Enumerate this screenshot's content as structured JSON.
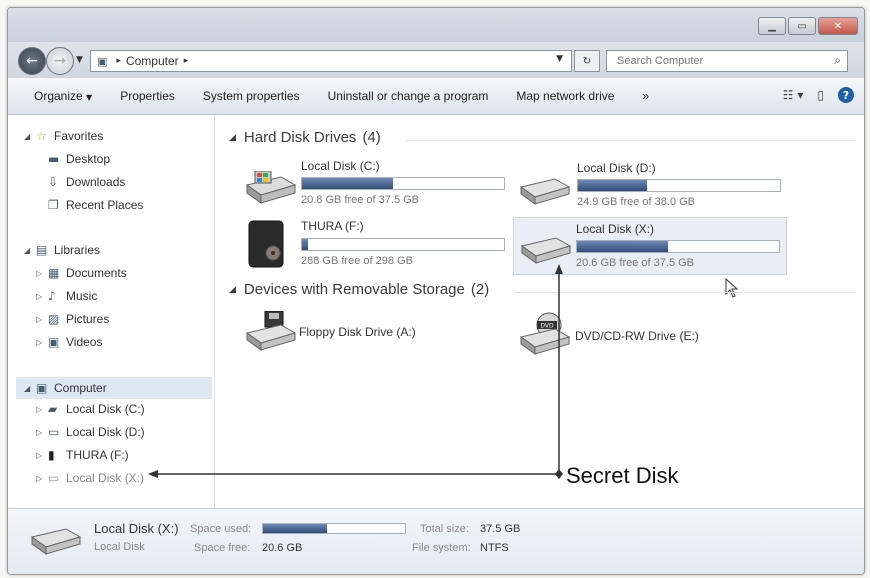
{
  "window": {
    "minimize_icon": "minimize-icon",
    "maximize_icon": "maximize-icon",
    "close_icon": "close-icon"
  },
  "address_bar": {
    "crumbs": [
      "Computer"
    ],
    "search_placeholder": "Search Computer"
  },
  "command_bar": {
    "organize": "Organize",
    "properties": "Properties",
    "system_properties": "System properties",
    "uninstall": "Uninstall or change a program",
    "map_network_drive": "Map network drive",
    "more": "»"
  },
  "nav": {
    "favorites": {
      "label": "Favorites",
      "items": [
        "Desktop",
        "Downloads",
        "Recent Places"
      ]
    },
    "libraries": {
      "label": "Libraries",
      "items": [
        "Documents",
        "Music",
        "Pictures",
        "Videos"
      ]
    },
    "computer": {
      "label": "Computer",
      "items": [
        "Local Disk (C:)",
        "Local Disk (D:)",
        "THURA (F:)",
        "Local Disk (X:)"
      ]
    }
  },
  "groups": {
    "hard_disk": {
      "label": "Hard Disk Drives",
      "count": "(4)"
    },
    "removable": {
      "label": "Devices with Removable Storage",
      "count": "(2)"
    }
  },
  "drives": [
    {
      "name": "Local Disk (C:)",
      "free": "20.8 GB free of 37.5 GB",
      "used_fraction": 0.45
    },
    {
      "name": "Local Disk (D:)",
      "free": "24.9 GB free of 38.0 GB",
      "used_fraction": 0.34
    },
    {
      "name": "THURA (F:)",
      "free": "288 GB free of 298 GB",
      "used_fraction": 0.03
    },
    {
      "name": "Local Disk (X:)",
      "free": "20.6 GB free of 37.5 GB",
      "used_fraction": 0.45
    }
  ],
  "removable": [
    {
      "name": "Floppy Disk Drive (A:)"
    },
    {
      "name": "DVD/CD-RW Drive (E:)"
    }
  ],
  "annotation": {
    "label": "Secret Disk"
  },
  "details": {
    "name": "Local Disk (X:)",
    "type": "Local Disk",
    "space_used_label": "Space used:",
    "space_free_label": "Space free:",
    "space_free": "20.6 GB",
    "used_fraction": 0.45,
    "total_size_label": "Total size:",
    "total_size": "37.5 GB",
    "file_system_label": "File system:",
    "file_system": "NTFS"
  }
}
